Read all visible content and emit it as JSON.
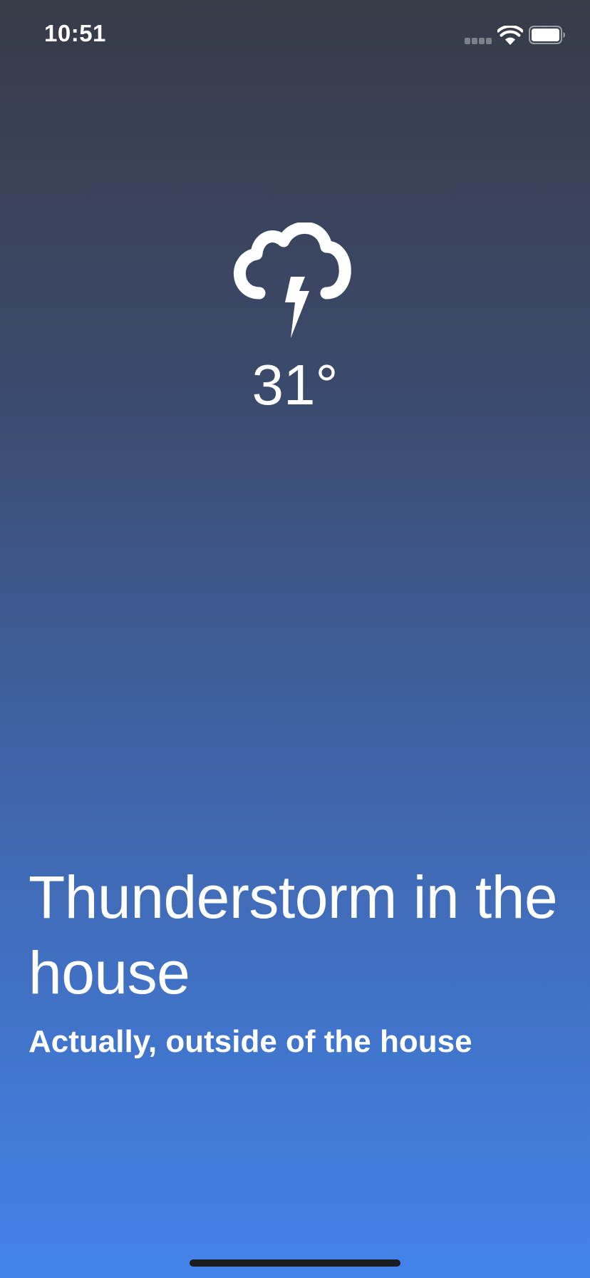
{
  "status_bar": {
    "time": "10:51",
    "icons": [
      "signal-icon",
      "wifi-icon",
      "battery-icon"
    ]
  },
  "weather": {
    "icon": "thunderstorm-icon",
    "temperature": "31°"
  },
  "headline": "Thunderstorm in the house",
  "subheadline": "Actually, outside of the house",
  "colors": {
    "gradient_top": "#383b48",
    "gradient_bottom": "#4383ea",
    "text": "#ffffff",
    "home_indicator": "#1b1c20"
  }
}
